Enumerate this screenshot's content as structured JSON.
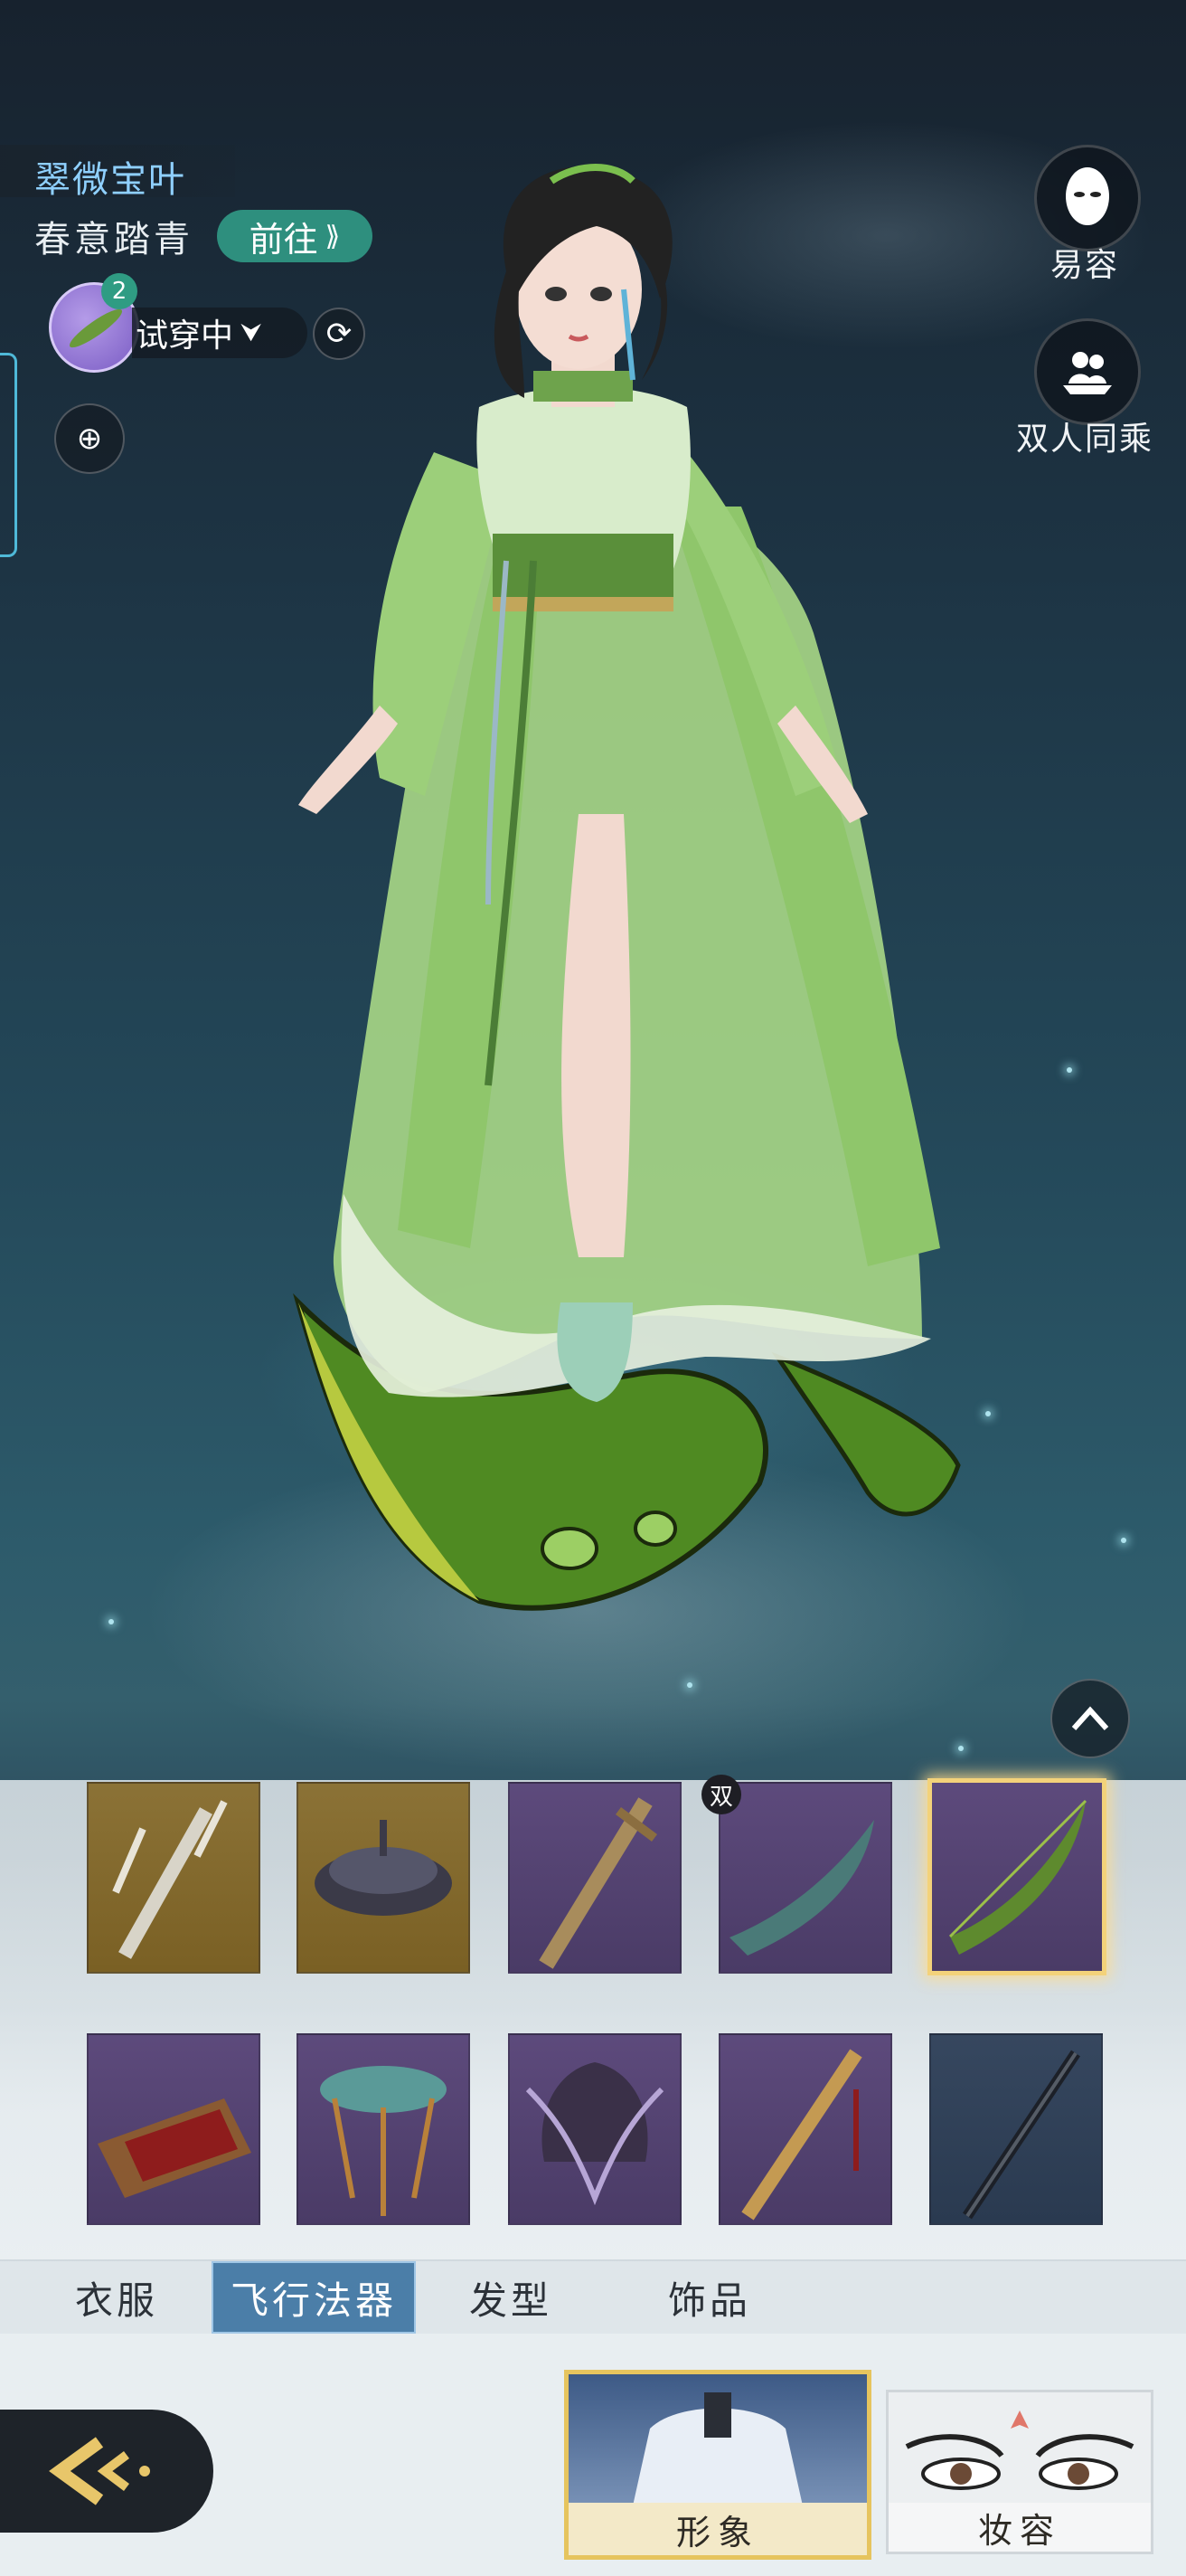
{
  "header": {
    "outfit_name": "翠微宝叶",
    "set_name": "春意踏青",
    "goto_label": "前往",
    "tryon_count": "2",
    "tryon_label": "试穿中"
  },
  "right_menu": {
    "makeover_label": "易容",
    "duo_ride_label": "双人同乘"
  },
  "grid": {
    "double_tag": "双",
    "items": [
      {
        "name": "twin-swords",
        "rarity": "gold"
      },
      {
        "name": "dark-disc",
        "rarity": "gold"
      },
      {
        "name": "carved-staff",
        "rarity": "purple"
      },
      {
        "name": "bone-boat",
        "rarity": "purple"
      },
      {
        "name": "green-leaf",
        "rarity": "purple",
        "selected": true
      },
      {
        "name": "bamboo-raft",
        "rarity": "purple"
      },
      {
        "name": "lotus-lantern",
        "rarity": "purple"
      },
      {
        "name": "winged-bell",
        "rarity": "purple"
      },
      {
        "name": "golden-sword",
        "rarity": "purple"
      },
      {
        "name": "iron-sword",
        "rarity": "blue"
      }
    ]
  },
  "tabs": [
    {
      "label": "衣服",
      "active": false
    },
    {
      "label": "飞行法器",
      "active": true
    },
    {
      "label": "发型",
      "active": false
    },
    {
      "label": "饰品",
      "active": false
    }
  ],
  "bottom": {
    "appearance_label": "形象",
    "makeup_label": "妆容"
  },
  "colors": {
    "accent_teal": "#2e8f7e",
    "tab_active": "#4b7ea8",
    "title_blue": "#8fd0ff",
    "selected_gold": "#f3d27a"
  }
}
